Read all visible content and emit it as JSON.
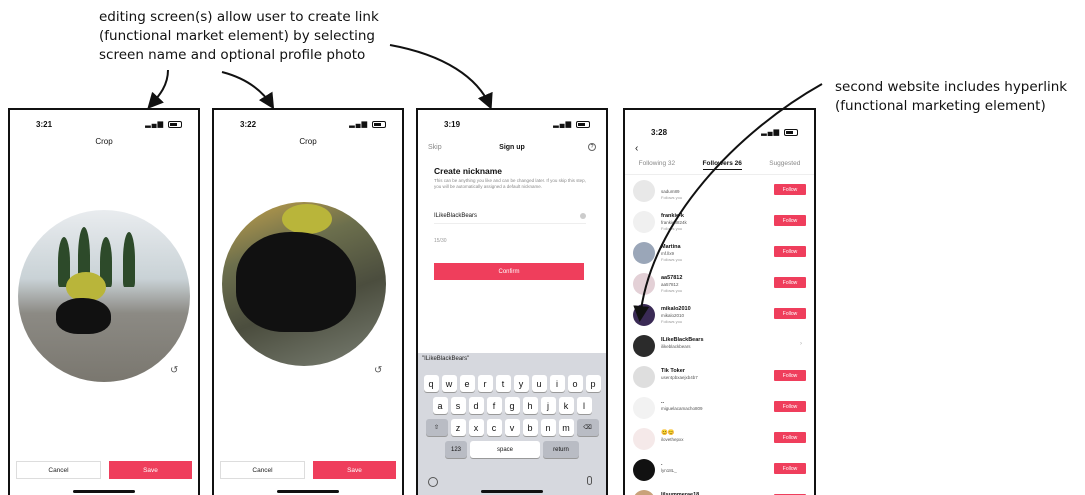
{
  "annotations": {
    "top_line1": "editing screen(s) allow user to create link",
    "top_line2": "(functional market element) by selecting",
    "top_line3": "screen name and optional profile photo",
    "right_line1": "second website includes hyperlink",
    "right_line2": "(functional marketing element)"
  },
  "phone1": {
    "time": "3:21",
    "title": "Crop",
    "cancel": "Cancel",
    "save": "Save"
  },
  "phone2": {
    "time": "3:22",
    "title": "Crop",
    "cancel": "Cancel",
    "save": "Save"
  },
  "phone3": {
    "time": "3:19",
    "skip": "Skip",
    "title": "Sign up",
    "heading": "Create nickname",
    "description": "This can be anything you like and can be changed later. If you skip this step, you will be automatically assigned a default nickname.",
    "input_value": "ILikeBlackBears",
    "counter": "15/30",
    "confirm": "Confirm",
    "suggestion": "\"ILikeBlackBears\"",
    "keys_row1": [
      "q",
      "w",
      "e",
      "r",
      "t",
      "y",
      "u",
      "i",
      "o",
      "p"
    ],
    "keys_row2": [
      "a",
      "s",
      "d",
      "f",
      "g",
      "h",
      "j",
      "k",
      "l"
    ],
    "keys_row3": [
      "z",
      "x",
      "c",
      "v",
      "b",
      "n",
      "m"
    ],
    "key_123": "123",
    "key_space": "space",
    "key_return": "return",
    "shift_key": "⇧",
    "delete_key": "⌫"
  },
  "phone4": {
    "time": "3:28",
    "tabs": [
      "Following 32",
      "Followers 26",
      "Suggested"
    ],
    "follow_label": "Follow",
    "rows": [
      {
        "name": "",
        "sub": "sadum89",
        "fol": "Follows you",
        "btn": true
      },
      {
        "name": "frankie-k",
        "sub": "frankie8824k",
        "fol": "Follows you",
        "btn": true
      },
      {
        "name": "Martina",
        "sub": "mf.llx9",
        "fol": "Follows you",
        "btn": true
      },
      {
        "name": "aa57812",
        "sub": "aa57812",
        "fol": "Follows you",
        "btn": true
      },
      {
        "name": "mikalo2010",
        "sub": "mikalo2010",
        "fol": "Follows you",
        "btn": true
      },
      {
        "name": "ILikeBlackBears",
        "sub": "ilikeblackbears",
        "fol": "",
        "btn": false
      },
      {
        "name": "Tik Toker",
        "sub": "user4pbxaejxb4b7",
        "fol": "",
        "btn": true
      },
      {
        "name": "..",
        "sub": "miguelacamacho809",
        "fol": "",
        "btn": true
      },
      {
        "name": "😊😊",
        "sub": "ilovethepxx",
        "fol": "",
        "btn": true
      },
      {
        "name": ".",
        "sub": "lyn18L_",
        "fol": "",
        "btn": true
      },
      {
        "name": "lilsummerae18",
        "sub": "sharrn_osag",
        "fol": "",
        "btn": true
      }
    ]
  }
}
